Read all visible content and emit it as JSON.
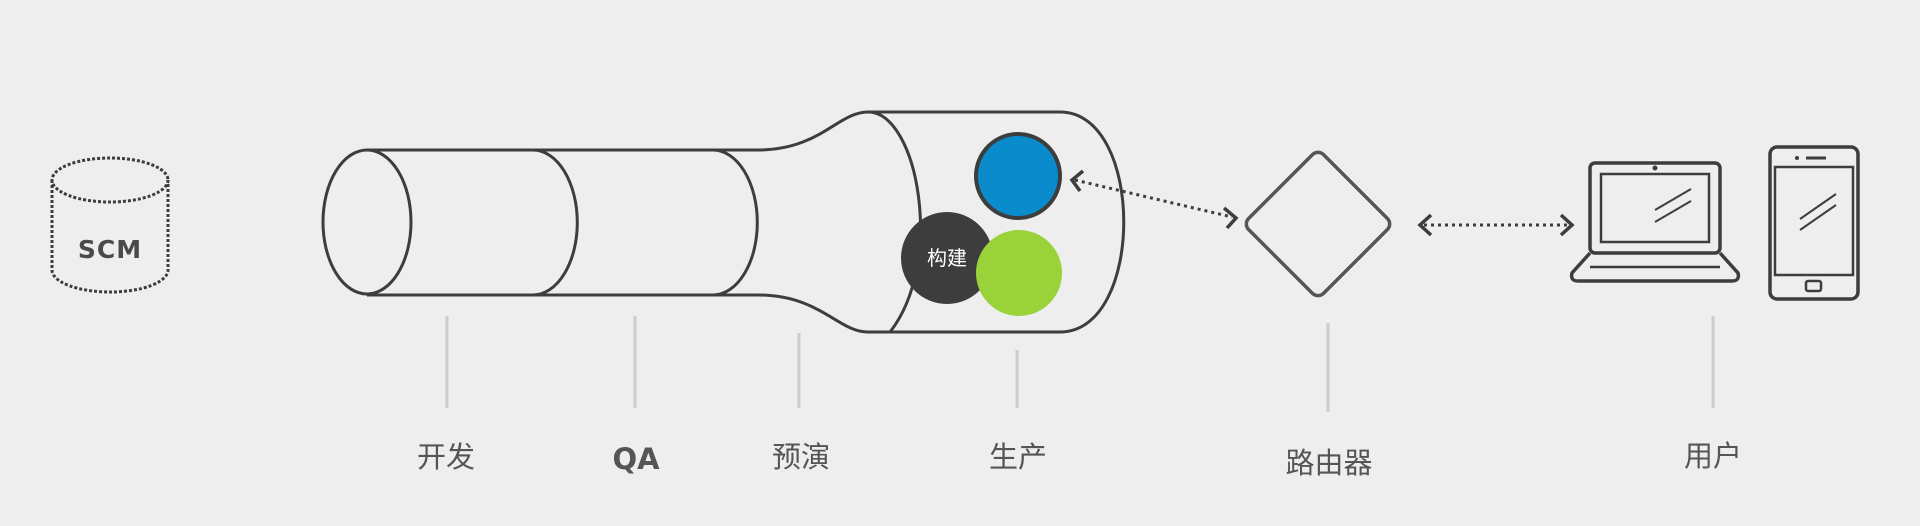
{
  "scm": {
    "label": "SCM"
  },
  "pipeline": {
    "build_label": "构建",
    "stages": [
      {
        "label": "开发"
      },
      {
        "label": "QA"
      },
      {
        "label": "预演"
      },
      {
        "label": "生产"
      }
    ]
  },
  "router": {
    "label": "路由器"
  },
  "users": {
    "label": "用户"
  },
  "colors": {
    "background": "#eeeeee",
    "outline": "#3d3d3d",
    "blue_node": "#0a8ccc",
    "green_node": "#9ad23a",
    "build_node": "#3d3d3d",
    "leader_line": "#cccccc"
  }
}
